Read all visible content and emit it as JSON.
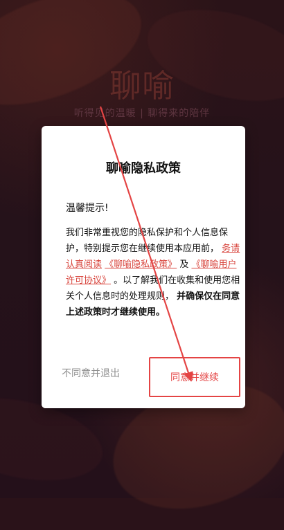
{
  "brand": {
    "logo_text": "聊喻",
    "subtitle": "听得见的温暖 | 聊得来的陪伴"
  },
  "dialog": {
    "title": "聊喻隐私政策",
    "greeting": "温馨提示!",
    "body": {
      "p1": "我们非常重视您的隐私保护和个人信息保护，特别提示您在继续使用本应用前，",
      "p2": "务请认真阅读",
      "link1": "《聊喻隐私政策》",
      "p3": "及",
      "link2": "《聊喻用户许可协议》",
      "p4": "。以了解我们在收集和使用您相关个人信息时的处理规则，",
      "p5": "并确保仅在同意上述政策时才继续使用。"
    },
    "buttons": {
      "decline": "不同意并退出",
      "accept": "同意并继续"
    }
  },
  "colors": {
    "accent": "#e44444",
    "background": "#2a1219",
    "link": "#d8443c"
  }
}
